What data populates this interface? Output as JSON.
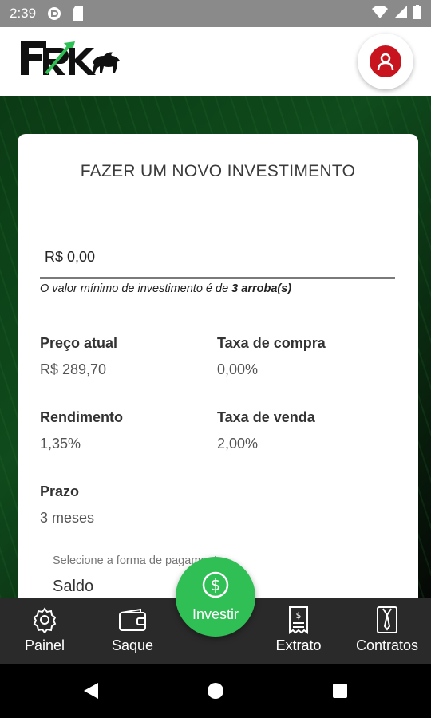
{
  "status_bar": {
    "time": "2:39",
    "icons": [
      "pocket-casts-icon",
      "sd-card-icon",
      "wifi-icon",
      "signal-icon",
      "battery-icon"
    ]
  },
  "header": {
    "logo_text": "FRK",
    "profile_icon": "user-icon",
    "accent_color": "#c8141e"
  },
  "card": {
    "title": "FAZER UM NOVO INVESTIMENTO",
    "amount_value": "R$ 0,00",
    "min_note_prefix": "O valor mínimo de investimento é de ",
    "min_note_bold": "3 arroba(s)",
    "fields": {
      "preco_atual": {
        "label": "Preço atual",
        "value": "R$ 289,70"
      },
      "taxa_compra": {
        "label": "Taxa de compra",
        "value": "0,00%"
      },
      "rendimento": {
        "label": "Rendimento",
        "value": "1,35%"
      },
      "taxa_venda": {
        "label": "Taxa de venda",
        "value": "2,00%"
      },
      "prazo": {
        "label": "Prazo",
        "value": "3 meses"
      }
    },
    "payment_caption": "Selecione a forma de pagamento",
    "payment_selected": "Saldo"
  },
  "bottom_nav": {
    "items": [
      {
        "label": "Painel",
        "icon": "gear-icon"
      },
      {
        "label": "Saque",
        "icon": "wallet-icon"
      },
      {
        "label": "Extrato",
        "icon": "receipt-icon"
      },
      {
        "label": "Contratos",
        "icon": "contract-icon"
      }
    ],
    "fab": {
      "label": "Investir",
      "icon": "dollar-icon",
      "color": "#2fbf55"
    }
  },
  "system_nav": {
    "icons": [
      "back-icon",
      "home-icon",
      "recents-icon"
    ]
  }
}
